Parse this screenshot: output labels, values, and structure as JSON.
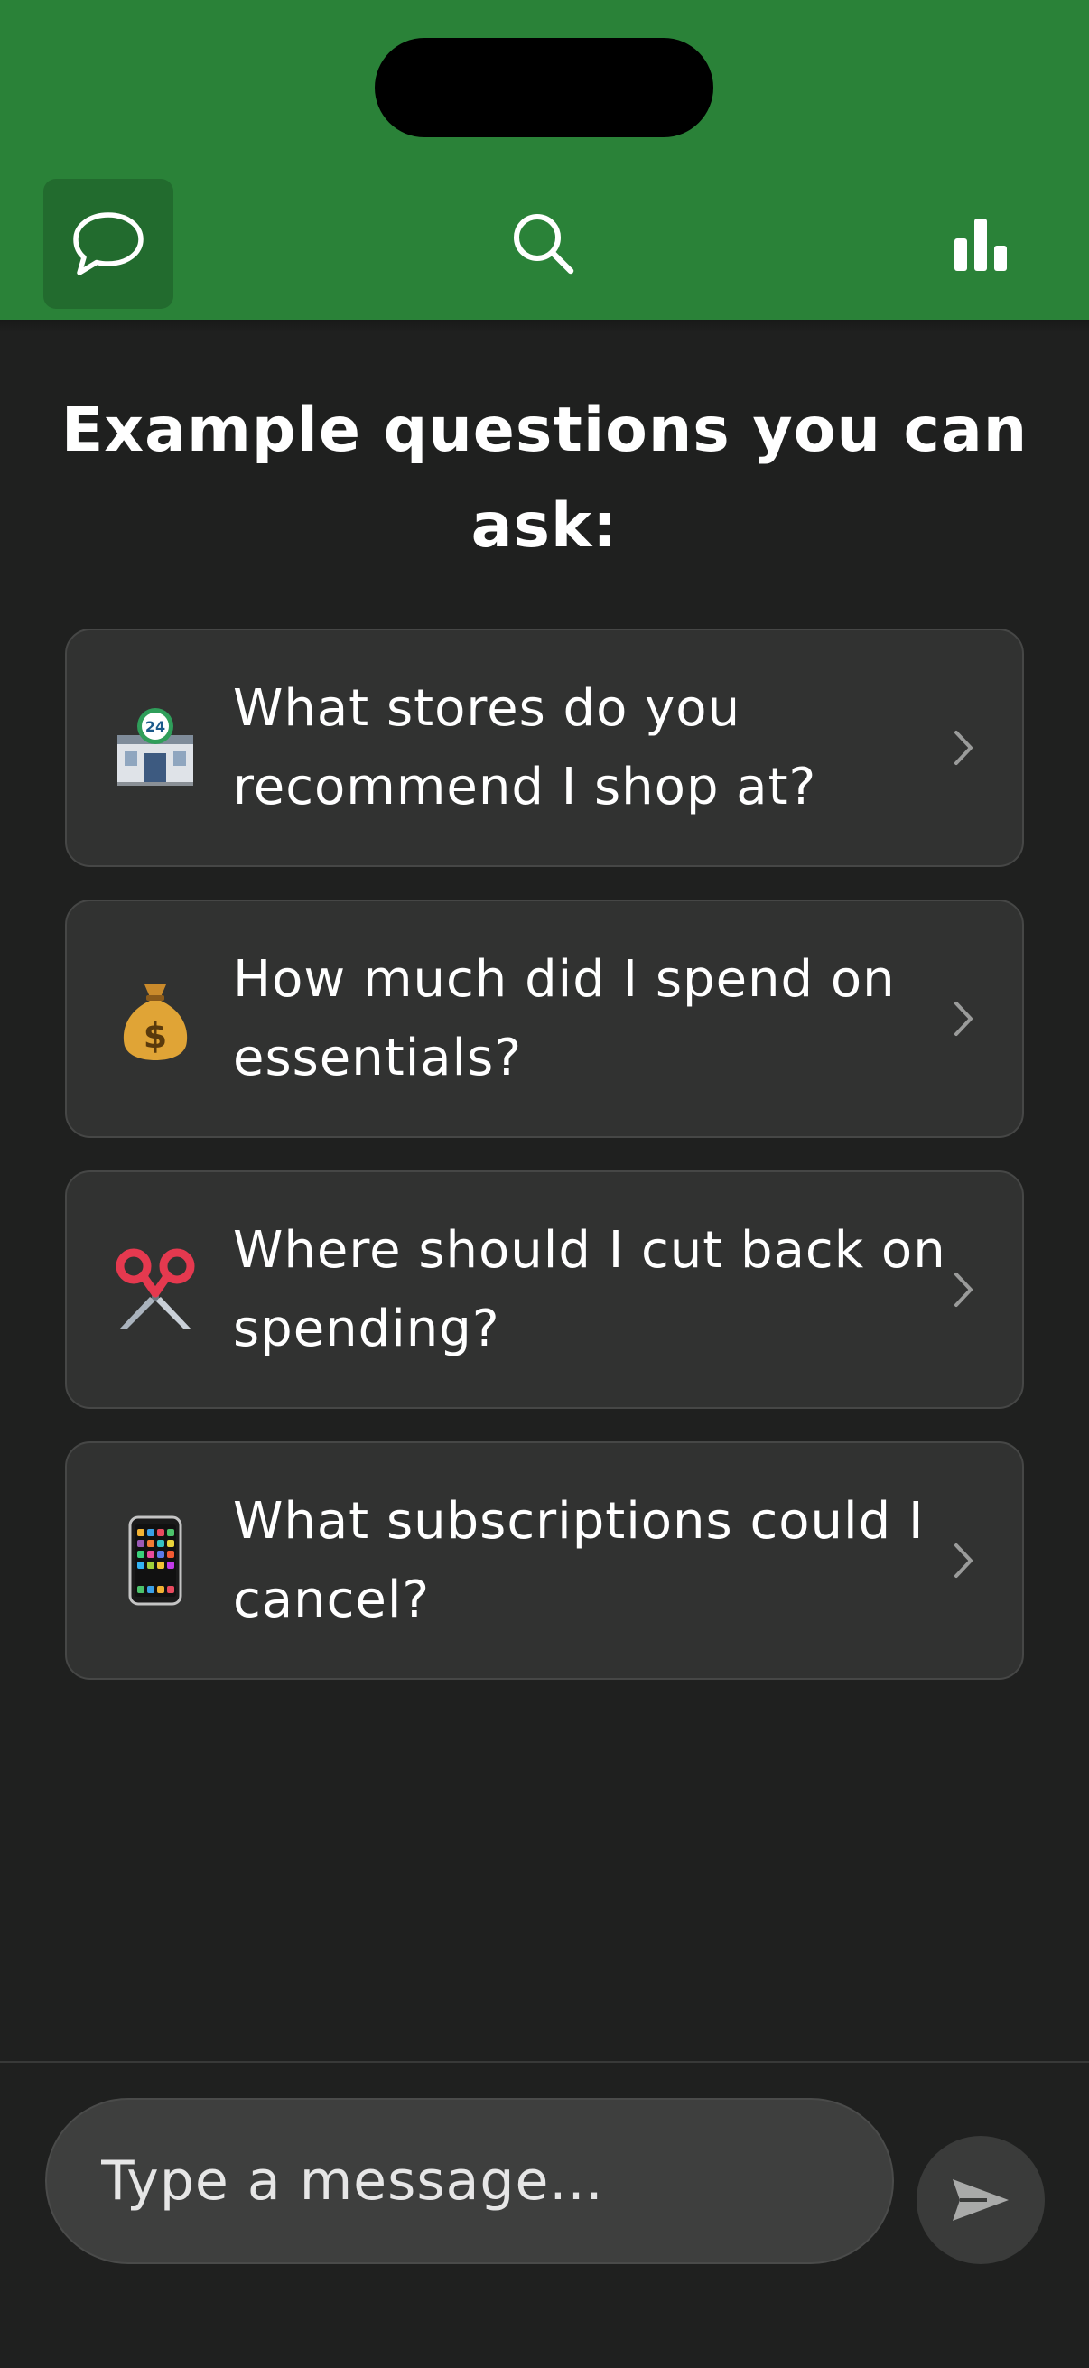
{
  "nav": {
    "items": [
      {
        "name": "chat",
        "icon": "chat-bubble-icon",
        "active": true
      },
      {
        "name": "search",
        "icon": "search-icon",
        "active": false
      },
      {
        "name": "stats",
        "icon": "bar-chart-icon",
        "active": false
      }
    ]
  },
  "main": {
    "title": "Example questions you can ask:",
    "questions": [
      {
        "emoji": "🏪",
        "icon": "convenience-store-icon",
        "text": "What stores do you recommend I shop at?"
      },
      {
        "emoji": "💰",
        "icon": "money-bag-icon",
        "text": "How much did I spend on essentials?"
      },
      {
        "emoji": "✂️",
        "icon": "scissors-icon",
        "text": "Where should I cut back on spending?"
      },
      {
        "emoji": "📱",
        "icon": "mobile-phone-icon",
        "text": "What subscriptions could I cancel?"
      }
    ]
  },
  "composer": {
    "placeholder": "Type a message...",
    "send_icon": "send-icon"
  },
  "colors": {
    "header": "#2a8238",
    "header_active": "#226b2e",
    "background": "#1f201f",
    "card": "#313231"
  }
}
